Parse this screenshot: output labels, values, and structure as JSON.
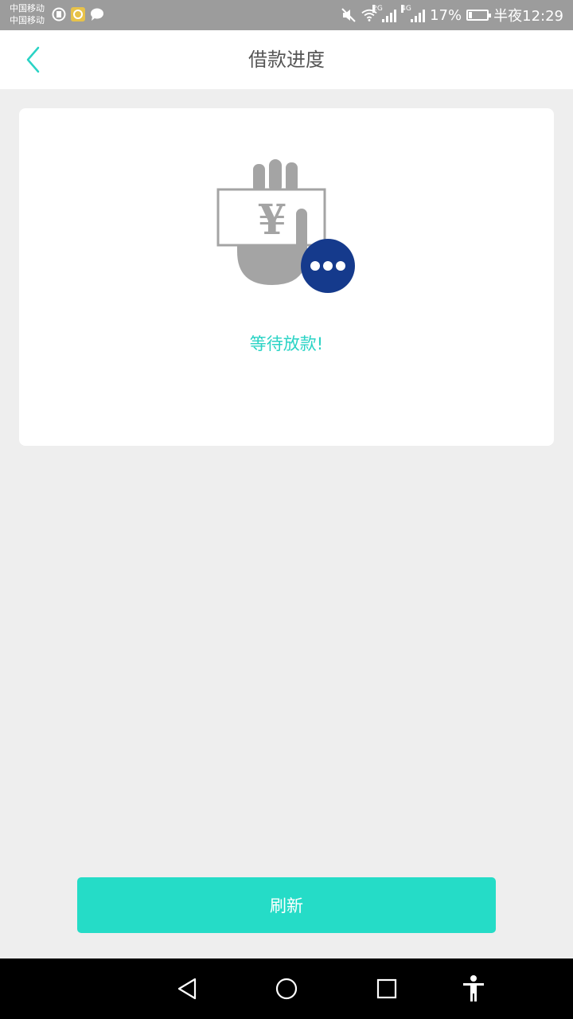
{
  "status_bar": {
    "carrier_1": "中国移动",
    "carrier_2": "中国移动",
    "net_1": "2G",
    "net_2": "4G",
    "battery": "17%",
    "battery_level": 0.17,
    "time": "半夜12:29"
  },
  "header": {
    "title": "借款进度",
    "accent_color": "#2ad3c5"
  },
  "card": {
    "status_text": "等待放款!",
    "currency_symbol": "¥"
  },
  "actions": {
    "refresh_label": "刷新",
    "button_color": "#25dcc7"
  },
  "nav": {
    "icons": [
      "back-icon",
      "home-icon",
      "recents-icon",
      "accessibility-icon"
    ]
  }
}
